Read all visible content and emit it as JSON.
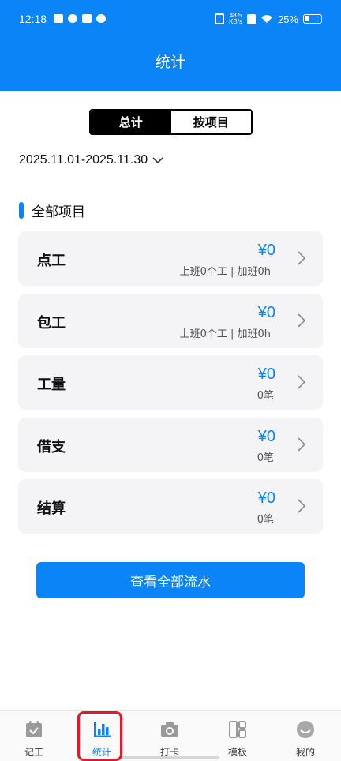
{
  "status_bar": {
    "time": "12:18",
    "net_speed_value": "48.5",
    "net_speed_unit": "KB/s",
    "battery": "25%"
  },
  "header": {
    "title": "统计"
  },
  "segment": {
    "total_label": "总计",
    "by_project_label": "按项目",
    "selected": "总计"
  },
  "date_range": "2025.11.01-2025.11.30",
  "section_title": "全部项目",
  "items": [
    {
      "label": "点工",
      "amount": "¥0",
      "sub": "上班0个工 | 加班0h"
    },
    {
      "label": "包工",
      "amount": "¥0",
      "sub": "上班0个工 | 加班0h"
    },
    {
      "label": "工量",
      "amount": "¥0",
      "sub": "0笔"
    },
    {
      "label": "借支",
      "amount": "¥0",
      "sub": "0笔"
    },
    {
      "label": "结算",
      "amount": "¥0",
      "sub": "0笔"
    }
  ],
  "view_all_button": "查看全部流水",
  "tabs": [
    {
      "label": "记工",
      "icon": "calendar-check-icon"
    },
    {
      "label": "统计",
      "icon": "bar-chart-icon"
    },
    {
      "label": "打卡",
      "icon": "camera-icon"
    },
    {
      "label": "模板",
      "icon": "template-grid-icon"
    },
    {
      "label": "我的",
      "icon": "profile-icon"
    }
  ],
  "active_tab": "统计",
  "colors": {
    "primary": "#0a84f7",
    "highlight": "#e0192d"
  }
}
